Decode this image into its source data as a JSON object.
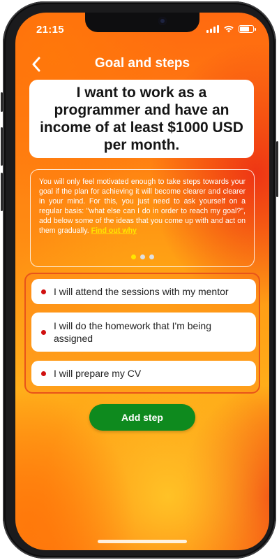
{
  "status_bar": {
    "time": "21:15",
    "signal_bars": 4,
    "battery_level": 0.75
  },
  "header": {
    "title": "Goal and steps",
    "back_icon": "chevron-left-icon"
  },
  "goal": {
    "text": "I want to work as a programmer and have an income of at least $1000 USD per month."
  },
  "info": {
    "text": "You will only feel motivated enough to take steps towards your goal if the plan for achieving it will become clearer and clearer in your mind. For this, you just need to ask yourself on a regular basis: \"what else can I do in order to reach my goal?\", add below some of the ideas that you come up with and act on them gradually.",
    "link_text": "Find out why",
    "page_count": 3,
    "active_page": 1
  },
  "steps": [
    {
      "text": "I will attend the sessions with my mentor"
    },
    {
      "text": "I will do the homework that I'm being assigned"
    },
    {
      "text": "I will prepare my CV"
    }
  ],
  "actions": {
    "add_step_label": "Add step"
  },
  "colors": {
    "accent_yellow": "#ffe600",
    "bullet_red": "#d01010",
    "button_green": "#0e8a1e",
    "steps_border": "#e8541a"
  }
}
